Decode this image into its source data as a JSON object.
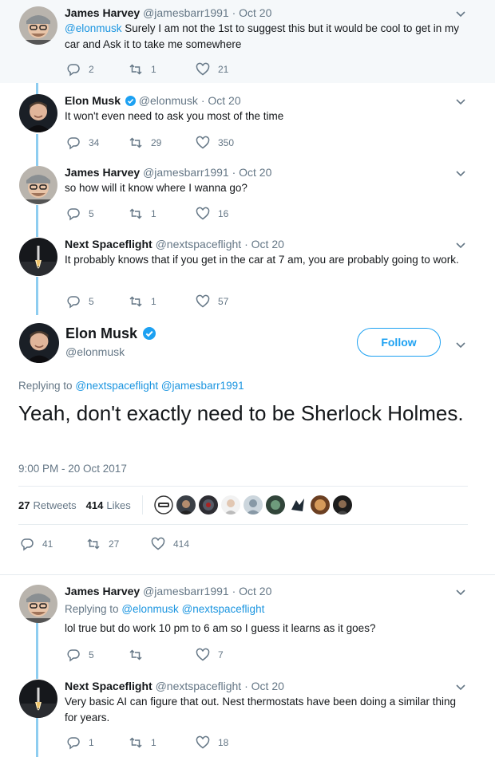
{
  "thread_top": [
    {
      "name": "James Harvey",
      "handle": "@jamesbarr1991",
      "time": "Oct 20",
      "mention": "@elonmusk",
      "text": " Surely I am not the 1st to suggest this but it would be cool to get in my car and Ask it to take me somewhere",
      "replies": "2",
      "retweets": "1",
      "likes": "21"
    },
    {
      "name": "Elon Musk",
      "handle": "@elonmusk",
      "time": "Oct 20",
      "text": "It won't even need to ask you most of the time",
      "replies": "34",
      "retweets": "29",
      "likes": "350"
    },
    {
      "name": "James Harvey",
      "handle": "@jamesbarr1991",
      "time": "Oct 20",
      "text": "so how will it know where I wanna go?",
      "replies": "5",
      "retweets": "1",
      "likes": "16"
    },
    {
      "name": "Next Spaceflight",
      "handle": "@nextspaceflight",
      "time": "Oct 20",
      "text": "It probably knows that if you get in the car at 7 am, you are probably going to work.",
      "replies": "5",
      "retweets": "1",
      "likes": "57"
    }
  ],
  "main_tweet": {
    "name": "Elon Musk",
    "handle": "@elonmusk",
    "follow_label": "Follow",
    "replying_prefix": "Replying to",
    "replying_1": "@nextspaceflight",
    "replying_2": "@jamesbarr1991",
    "text": "Yeah, don't exactly need to be Sherlock Holmes.",
    "timestamp": "9:00 PM - 20 Oct 2017",
    "retweets_count": "27",
    "retweets_label": "Retweets",
    "likes_count": "414",
    "likes_label": "Likes",
    "replies": "41",
    "retweets": "27",
    "likes": "414"
  },
  "replies_below": [
    {
      "name": "James Harvey",
      "handle": "@jamesbarr1991",
      "time": "Oct 20",
      "replying_prefix": "Replying to",
      "replying_1": "@elonmusk",
      "replying_2": "@nextspaceflight",
      "text": "lol true but do work 10 pm to 6 am so I guess it learns as it goes?",
      "replies": "5",
      "retweets": "",
      "likes": "7"
    },
    {
      "name": "Next Spaceflight",
      "handle": "@nextspaceflight",
      "time": "Oct 20",
      "text": "Very basic AI can figure that out. Nest thermostats have been doing a similar thing for years.",
      "replies": "1",
      "retweets": "1",
      "likes": "18"
    }
  ],
  "colors": {
    "link": "#1b95e0",
    "muted": "#657786",
    "thread_line": "#8ecdf0",
    "highlight_bg": "#f5f8fa",
    "verified": "#1da1f2"
  }
}
